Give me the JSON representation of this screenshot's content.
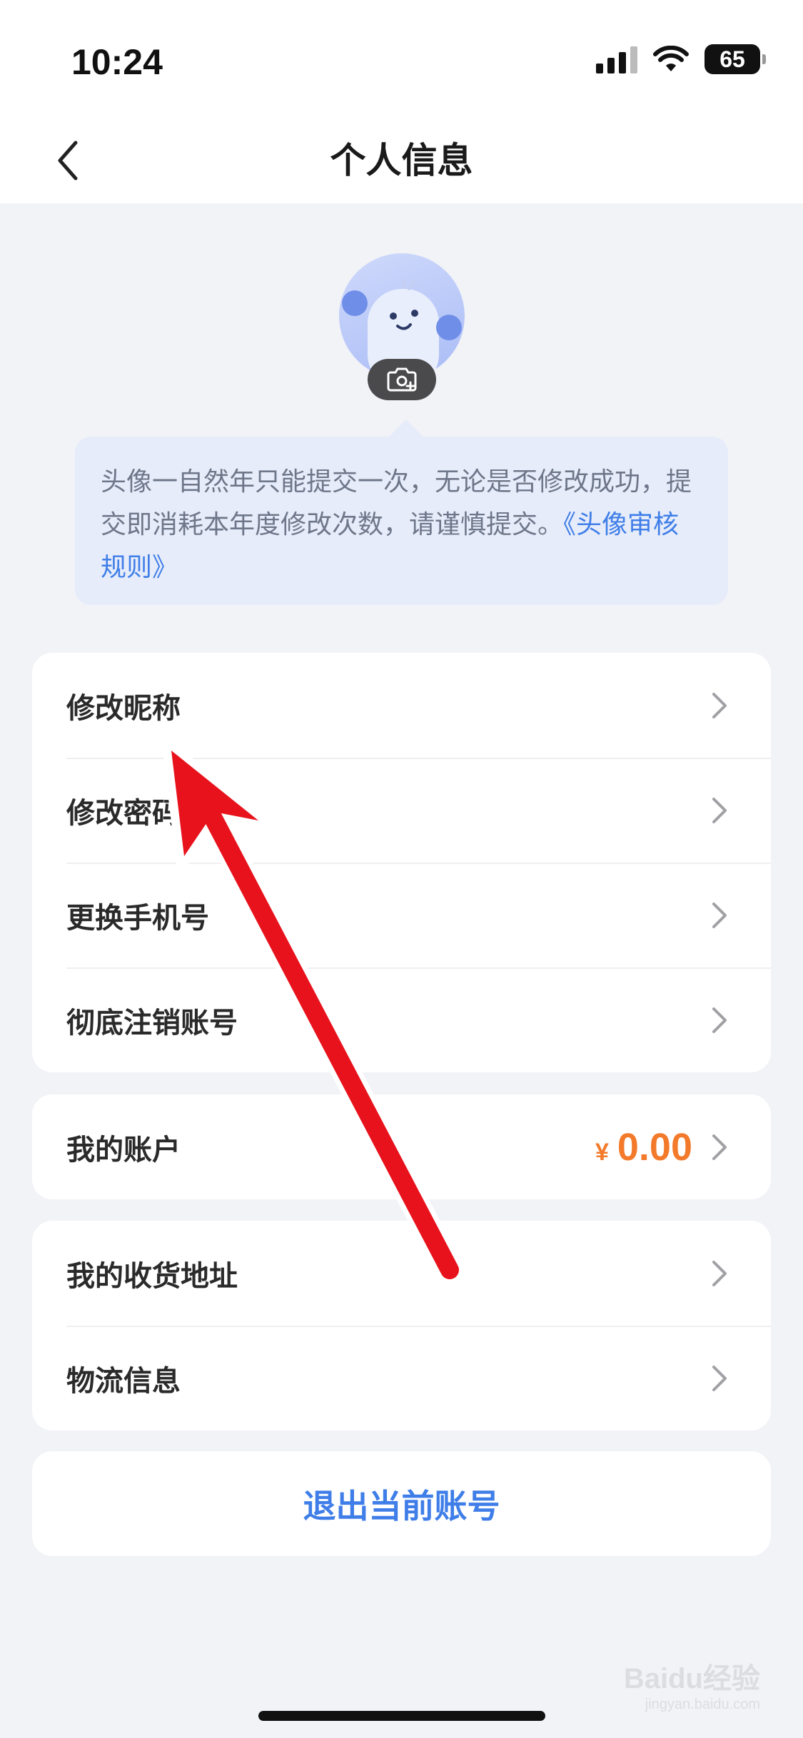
{
  "status_bar": {
    "time": "10:24",
    "battery": "65"
  },
  "nav": {
    "title": "个人信息"
  },
  "avatar_tip": {
    "text": "头像一自然年只能提交一次，无论是否修改成功，提交即消耗本年度修改次数，请谨慎提交。",
    "link": "《头像审核规则》"
  },
  "security_section": {
    "items": [
      {
        "label": "修改昵称"
      },
      {
        "label": "修改密码"
      },
      {
        "label": "更换手机号"
      },
      {
        "label": "彻底注销账号"
      }
    ]
  },
  "account_section": {
    "label": "我的账户",
    "currency": "¥",
    "balance": "0.00"
  },
  "address_section": {
    "items": [
      {
        "label": "我的收货地址"
      },
      {
        "label": "物流信息"
      }
    ]
  },
  "logout_label": "退出当前账号",
  "watermark": {
    "brand": "Baidu经验",
    "url": "jingyan.baidu.com"
  },
  "colors": {
    "accent": "#3f7ee8",
    "balance": "#f37a2a",
    "annotation_arrow": "#e8121c"
  }
}
